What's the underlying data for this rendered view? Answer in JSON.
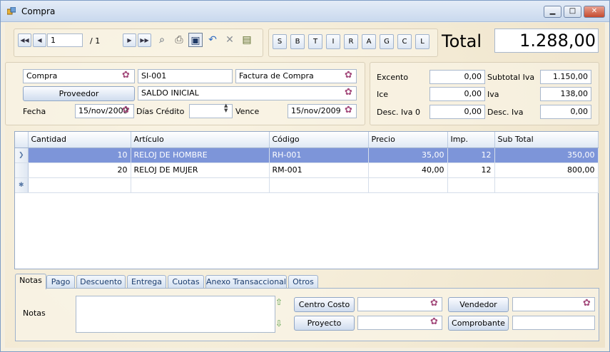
{
  "window": {
    "title": "Compra"
  },
  "nav": {
    "record": "1",
    "total_records": "/ 1",
    "first_icon": "first-record-icon",
    "prev_icon": "prev-record-icon",
    "next_icon": "next-record-icon",
    "last_icon": "last-record-icon"
  },
  "toolbar_icons": [
    "binoculars-icon",
    "print-icon",
    "save-icon",
    "undo-icon",
    "delete-icon",
    "export-icon"
  ],
  "letters": [
    "S",
    "B",
    "T",
    "I",
    "R",
    "A",
    "G",
    "C",
    "L"
  ],
  "total": {
    "label": "Total",
    "value": "1.288,00"
  },
  "header": {
    "doc_type": "Compra",
    "doc_number": "SI-001",
    "doc_kind": "Factura de Compra",
    "provider_button": "Proveedor",
    "provider_name": "SALDO INICIAL",
    "fecha_label": "Fecha",
    "fecha_value": "15/nov/2009",
    "dias_label": "Días Crédito",
    "dias_value": "",
    "vence_label": "Vence",
    "vence_value": "15/nov/2009"
  },
  "totals": {
    "excento_label": "Excento",
    "excento": "0,00",
    "ice_label": "Ice",
    "ice": "0,00",
    "desc_iva0_label": "Desc. Iva 0",
    "desc_iva0": "0,00",
    "subtotal_iva_label": "Subtotal Iva",
    "subtotal_iva": "1.150,00",
    "iva_label": "Iva",
    "iva": "138,00",
    "desc_iva_label": "Desc. Iva",
    "desc_iva": "0,00"
  },
  "grid": {
    "columns": [
      "Cantidad",
      "Artículo",
      "Código",
      "Precio",
      "Imp.",
      "Sub Total"
    ],
    "rows": [
      {
        "cantidad": "10",
        "articulo": "RELOJ DE HOMBRE",
        "codigo": "RH-001",
        "precio": "35,00",
        "imp": "12",
        "subtotal": "350,00"
      },
      {
        "cantidad": "20",
        "articulo": "RELOJ DE MUJER",
        "codigo": "RM-001",
        "precio": "40,00",
        "imp": "12",
        "subtotal": "800,00"
      }
    ]
  },
  "tabs": [
    "Notas",
    "Pago",
    "Descuento",
    "Entrega",
    "Cuotas",
    "Anexo Transaccional",
    "Otros"
  ],
  "notas": {
    "label": "Notas",
    "value": "",
    "centro_costo": "Centro Costo",
    "proyecto": "Proyecto",
    "vendedor": "Vendedor",
    "comprobante": "Comprobante"
  },
  "colors": {
    "selection": "#7d95d9",
    "accent": "#1c3d6e"
  }
}
